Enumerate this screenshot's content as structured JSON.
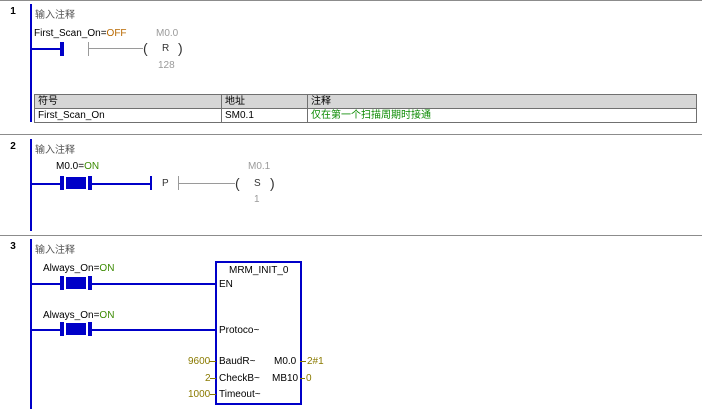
{
  "networks": [
    {
      "number": "1",
      "comment": "输入注释",
      "contact": {
        "name": "First_Scan_On",
        "state": "OFF"
      },
      "coil": {
        "address": "M0.0",
        "type": "R",
        "count": "128"
      },
      "symbol_table": {
        "headers": [
          "符号",
          "地址",
          "注释"
        ],
        "rows": [
          [
            "First_Scan_On",
            "SM0.1",
            "仅在第一个扫描周期时接通"
          ]
        ]
      }
    },
    {
      "number": "2",
      "comment": "输入注释",
      "contact": {
        "name": "M0.0",
        "state": "ON"
      },
      "edge": "P",
      "coil": {
        "address": "M0.1",
        "type": "S",
        "count": "1"
      }
    },
    {
      "number": "3",
      "comment": "输入注释",
      "contact1": {
        "name": "Always_On",
        "state": "ON"
      },
      "contact2": {
        "name": "Always_On",
        "state": "ON"
      },
      "block": {
        "title": "MRM_INIT_0",
        "en": "EN",
        "protocol": "Protoco~",
        "baud": {
          "label": "BaudR~",
          "value": "9600"
        },
        "check": {
          "label": "CheckB~",
          "value": "2"
        },
        "timeout": {
          "label": "Timeout~",
          "value": "1000"
        },
        "out1": {
          "label": "M0.0",
          "value": "2#1"
        },
        "out2": {
          "label": "MB10",
          "value": "0"
        }
      }
    }
  ],
  "colors": {
    "rail": "#0000c8",
    "on": "#3a8a00",
    "off": "#b86800",
    "disabled": "#9a9a9a"
  },
  "eq": "="
}
